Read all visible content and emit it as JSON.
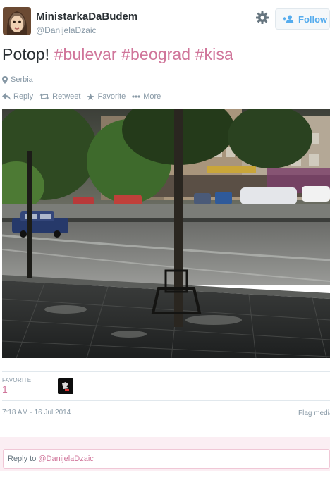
{
  "header": {
    "display_name": "MinistarkaDaBudem",
    "handle": "@DanijelaDzaic",
    "follow_label": "Follow",
    "icons": {
      "settings": "gear-icon",
      "follow": "add-user-icon"
    }
  },
  "tweet": {
    "text_plain": "Potop!",
    "hashtags": [
      "#bulevar",
      "#beograd",
      "#kisa"
    ],
    "location": "Serbia",
    "actions": [
      {
        "label": "Reply",
        "icon": "reply-icon"
      },
      {
        "label": "Retweet",
        "icon": "retweet-icon"
      },
      {
        "label": "Favorite",
        "icon": "star-icon"
      },
      {
        "label": "More",
        "icon": "more-dots-icon"
      }
    ]
  },
  "stats": {
    "favorites_label": "FAVORITE",
    "favorites_count": "1"
  },
  "meta": {
    "timestamp": "7:18 AM - 16 Jul 2014",
    "flag_media": "Flag media"
  },
  "reply": {
    "prefix": "Reply to",
    "mention": "@DanijelaDzaic"
  },
  "colors": {
    "accent": "#d0759a",
    "link_blue": "#55acee",
    "muted": "#8899a6",
    "reply_panel": "#fbeef3"
  }
}
